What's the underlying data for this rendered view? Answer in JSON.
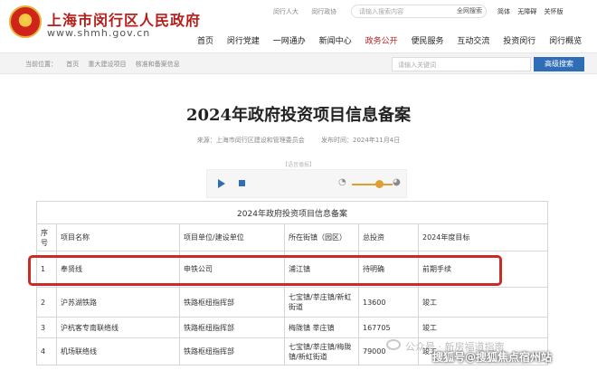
{
  "header": {
    "site_title": "上海市闵行区人民政府",
    "site_domain": "www.shmh.gov.cn",
    "top_links": [
      "闵行人大",
      "闵行政协"
    ],
    "search_placeholder": "请输入搜索内容",
    "search_button": "全网搜索",
    "lang": [
      "简体",
      "无障碍",
      "关怀版"
    ],
    "nav": [
      "首页",
      "闵行党建",
      "一网通办",
      "新闻中心",
      "政务公开",
      "便民服务",
      "互动交流",
      "投资闵行",
      "闵行概览"
    ]
  },
  "breadcrumb": {
    "items": [
      "当前位置：",
      "首页",
      "重大建设项目",
      "核准和备案信息"
    ],
    "search_placeholder": "请输入关键词",
    "search_button": "高级搜索"
  },
  "article": {
    "title": "2024年政府投资项目信息备案",
    "source": "来源：上海市闵行区建设和管理委员会",
    "date": "发布时间：2024年11月4日",
    "player_label": "【语音播报】"
  },
  "table": {
    "caption": "2024年政府投资项目信息备案",
    "headers": [
      "序号",
      "项目名称",
      "项目单位/建设单位",
      "所在街镇（园区）",
      "总投资",
      "2024年度目标"
    ],
    "rows": [
      [
        "1",
        "奉贤线",
        "申铁公司",
        "浦江镇",
        "待明确",
        "前期手续"
      ],
      [
        "2",
        "沪苏湖铁路",
        "铁路枢纽指挥部",
        "七宝镇/莘庄镇/新虹街道",
        "13600",
        "竣工"
      ],
      [
        "3",
        "沪杭客专南联络线",
        "铁路枢纽指挥部",
        "梅陇镇 莘庄镇",
        "167705",
        "竣工"
      ],
      [
        "4",
        "机场联络线",
        "铁路枢纽指挥部",
        "七宝镇/莘庄镇/梅陇镇/新虹街道",
        "79000",
        "竣工"
      ]
    ]
  },
  "watermarks": {
    "wm1": "公众号 · 新房福道指南",
    "wm2": "搜狐号@搜狐焦点宿州站"
  },
  "colors": {
    "brand_red": "#b51f1a",
    "highlight": "#cc2a25",
    "button_blue": "#2f6db6"
  }
}
